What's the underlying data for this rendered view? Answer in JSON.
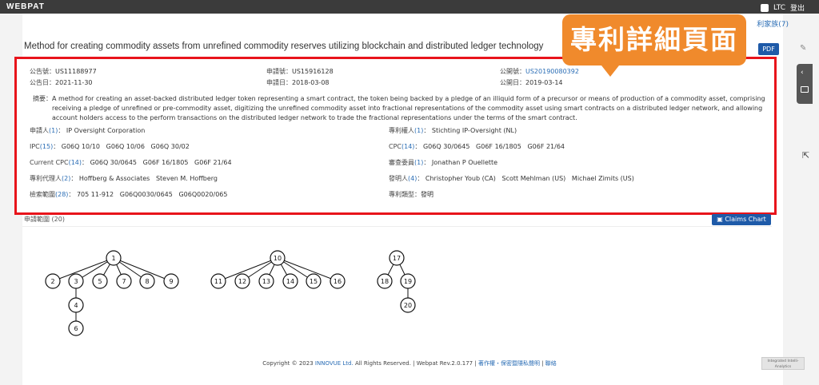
{
  "app": {
    "logo": "WEBPAT",
    "user": "LTC",
    "logout": "登出",
    "family_link": "利家族(7)"
  },
  "title": "Method for creating commodity assets from unrefined commodity reserves utilizing blockchain and distributed ledger technology",
  "pdf_label": "PDF",
  "callout": "專利詳細頁面",
  "info": {
    "pub_no_label": "公告號：",
    "pub_no": "US11188977",
    "app_no_label": "申請號：",
    "app_no": "US15916128",
    "open_no_label": "公開號：",
    "open_no": "US20190080392",
    "pub_date_label": "公告日：",
    "pub_date": "2021-11-30",
    "app_date_label": "申請日：",
    "app_date": "2018-03-08",
    "open_date_label": "公開日：",
    "open_date": "2019-03-14",
    "abstract_label": "摘要：",
    "abstract": "A method for creating an asset-backed distributed ledger token representing a smart contract, the token being backed by a pledge of an illiquid form of a precursor or means of production of a commodity asset, comprising receiving a pledge of unrefined or pre-commodity asset, digitizing the unrefined commodity asset into fractional representations of the commodity asset using smart contracts on a distributed ledger network, and allowing account holders access to the perform transactions on the distributed ledger network to trade the fractional representations under the terms of the smart contract.",
    "applicant_label": "申請人",
    "applicant_count": "(1)",
    "applicant": "IP Oversight Corporation",
    "assignee_label": "專利權人",
    "assignee_count": "(1)",
    "assignee": "Stichting IP-Oversight (NL)",
    "ipc_label": "IPC",
    "ipc_count": "(15)",
    "ipc": "G06Q 10/10   G06Q 10/06   G06Q 30/02",
    "cpc_label": "CPC",
    "cpc_count": "(14)",
    "cpc": "G06Q 30/0645   G06F 16/1805   G06F 21/64",
    "ccpc_label": "Current CPC",
    "ccpc_count": "(14)",
    "ccpc": "G06Q 30/0645   G06F 16/1805   G06F 21/64",
    "examiner_label": "審查委員",
    "examiner_count": "(1)",
    "examiner": "Jonathan P Ouellette",
    "agent_label": "專利代理人",
    "agent_count": "(2)",
    "agent": "Hoffberg & Associates   Steven M. Hoffberg",
    "inventor_label": "發明人",
    "inventor_count": "(4)",
    "inventor": "Christopher Youb (CA)   Scott Mehlman (US)   Michael Zimits (US)",
    "scope_label": "檢索範圍",
    "scope_count": "(28)",
    "scope": "705 11-912   G06Q0030/0645   G06Q0020/065",
    "type_label": "專利類型：",
    "type": "發明"
  },
  "claims": {
    "label": "申請範圍 (20)",
    "chart_btn": "Claims Chart"
  },
  "claim_tree": {
    "nodes": [
      "1",
      "2",
      "3",
      "5",
      "7",
      "8",
      "9",
      "4",
      "6",
      "10",
      "11",
      "12",
      "13",
      "14",
      "15",
      "16",
      "17",
      "18",
      "19",
      "20"
    ]
  },
  "footer": {
    "copyright": "Copyright © 2023",
    "company": "INNOVUE Ltd.",
    "rights": "All Rights Reserved. | Webpat Rev.2.0.177 |",
    "privacy": "著作權・保密暨隱私聲明",
    "sep": "|",
    "contact": "聯絡",
    "badge": "Integrated Intelli-Analytics"
  }
}
